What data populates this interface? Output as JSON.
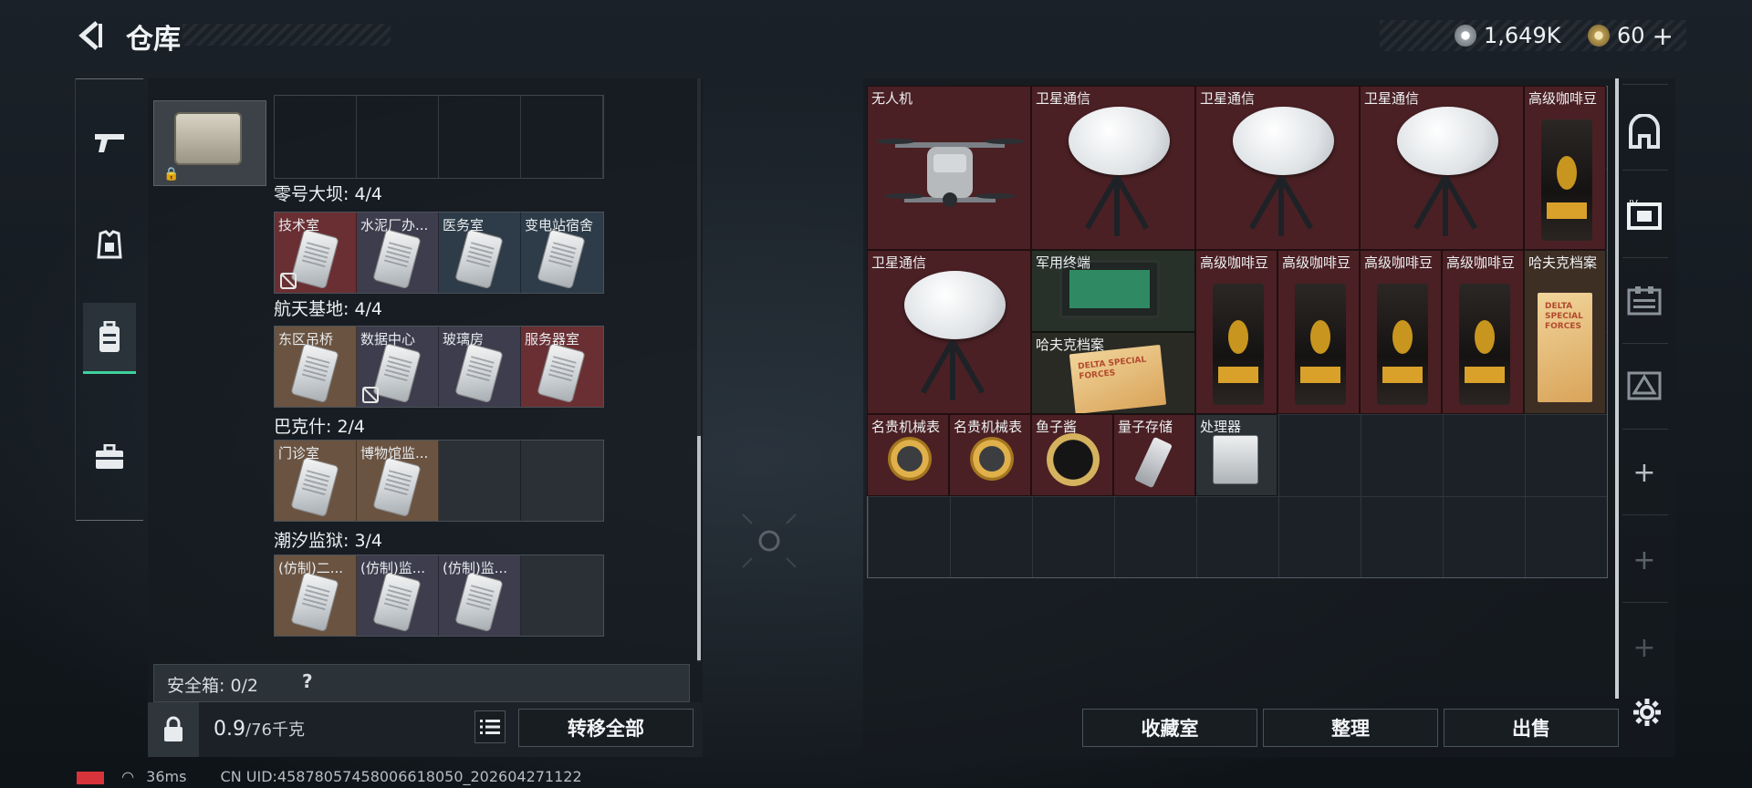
{
  "header": {
    "title": "仓库",
    "currency": [
      {
        "icon": "silver-coin-icon",
        "value": "1,649K"
      },
      {
        "icon": "gold-coin-icon",
        "value": "60"
      }
    ],
    "add_symbol": "+"
  },
  "left": {
    "thumb_lock": "🔒",
    "sections": [
      {
        "label": "零号大坝: 4/4",
        "keys": [
          {
            "name": "技术室",
            "color": "red",
            "disabled": true
          },
          {
            "name": "水泥厂办...",
            "color": "gray"
          },
          {
            "name": "医务室",
            "color": "blue"
          },
          {
            "name": "变电站宿舍",
            "color": "blue"
          }
        ]
      },
      {
        "label": "航天基地: 4/4",
        "keys": [
          {
            "name": "东区吊桥",
            "color": "tan"
          },
          {
            "name": "数据中心",
            "color": "gray",
            "disabled": true
          },
          {
            "name": "玻璃房",
            "color": "gray"
          },
          {
            "name": "服务器室",
            "color": "red"
          }
        ]
      },
      {
        "label": "巴克什: 2/4",
        "keys": [
          {
            "name": "门诊室",
            "color": "tan"
          },
          {
            "name": "博物馆监...",
            "color": "tan"
          },
          {
            "name": "",
            "color": "empty"
          },
          {
            "name": "",
            "color": "empty"
          }
        ]
      },
      {
        "label": "潮汐监狱: 3/4",
        "keys": [
          {
            "name": "(仿制)二...",
            "color": "tan"
          },
          {
            "name": "(仿制)监...",
            "color": "gray"
          },
          {
            "name": "(仿制)监...",
            "color": "gray"
          },
          {
            "name": "",
            "color": "empty"
          }
        ]
      }
    ],
    "safebox_label": "安全箱: 0/2",
    "safebox_help": "?",
    "weight_value": "0.9",
    "weight_total": "/76千克",
    "transfer_all": "转移全部"
  },
  "inventory": {
    "items": [
      {
        "name": "无人机",
        "kind": "drone"
      },
      {
        "name": "卫星通信",
        "kind": "dish"
      },
      {
        "name": "卫星通信",
        "kind": "dish"
      },
      {
        "name": "卫星通信",
        "kind": "dish"
      },
      {
        "name": "高级咖啡豆",
        "kind": "bag"
      },
      {
        "name": "卫星通信",
        "kind": "dish"
      },
      {
        "name": "军用终端",
        "kind": "tablet"
      },
      {
        "name": "高级咖啡豆",
        "kind": "bag"
      },
      {
        "name": "高级咖啡豆",
        "kind": "bag"
      },
      {
        "name": "高级咖啡豆",
        "kind": "bag"
      },
      {
        "name": "高级咖啡豆",
        "kind": "bag"
      },
      {
        "name": "哈夫克档案",
        "kind": "folder"
      },
      {
        "name": "哈夫克档案",
        "kind": "folder"
      },
      {
        "name": "名贵机械表",
        "kind": "watch"
      },
      {
        "name": "名贵机械表",
        "kind": "watch"
      },
      {
        "name": "鱼子酱",
        "kind": "tin"
      },
      {
        "name": "量子存储",
        "kind": "usb"
      },
      {
        "name": "处理器",
        "kind": "cpu"
      }
    ],
    "folder_print": "DELTA SPECIAL FORCES"
  },
  "actions": {
    "collection": "收藏室",
    "sort": "整理",
    "sell": "出售"
  },
  "status": {
    "ping": "36ms",
    "uid": "CN UID:45878057458006618050_202604271122"
  }
}
